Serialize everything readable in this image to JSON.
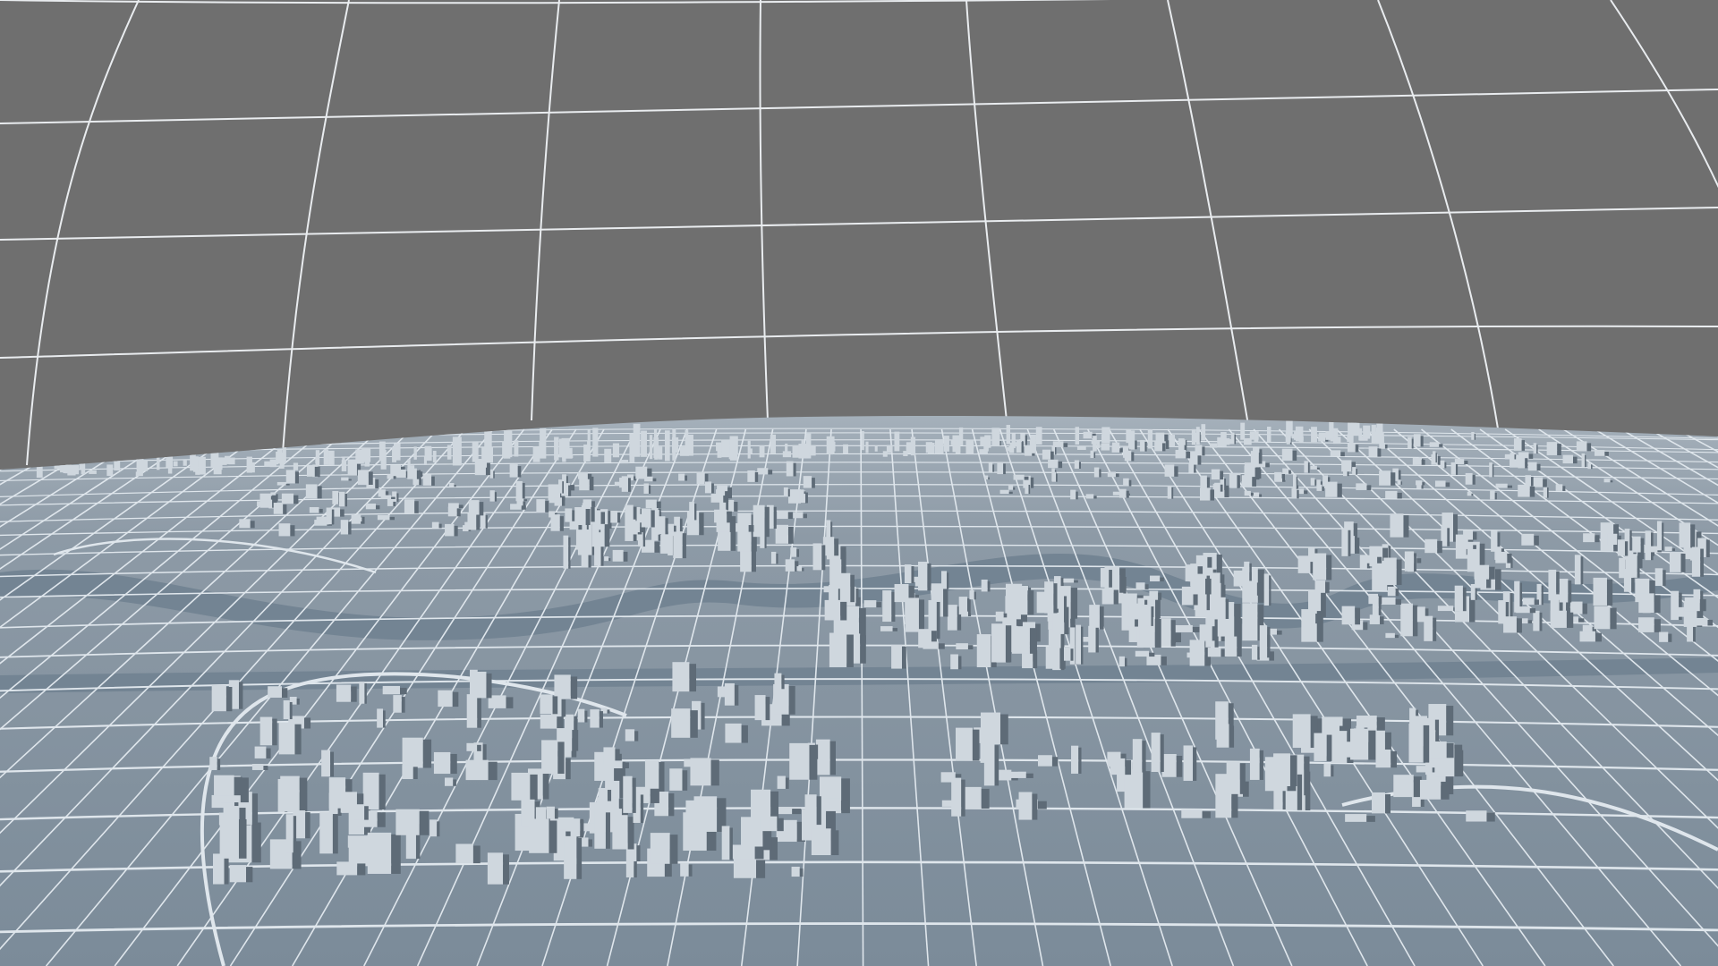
{
  "scene": {
    "subject": "3d-city-model-render",
    "view": "wireframe-dome-over-city",
    "colors": {
      "backdrop": "#6f6f6f",
      "backdrop_grid": "#e9ecef",
      "ground": "#7b8b99",
      "ground_far": "#8d9aa6",
      "roads": "#dfe6ec",
      "water": "#738493",
      "buildings_light": "#cfd7de",
      "buildings_shadow": "#5e6b77",
      "horizon_haze": "#a9b4be"
    }
  }
}
